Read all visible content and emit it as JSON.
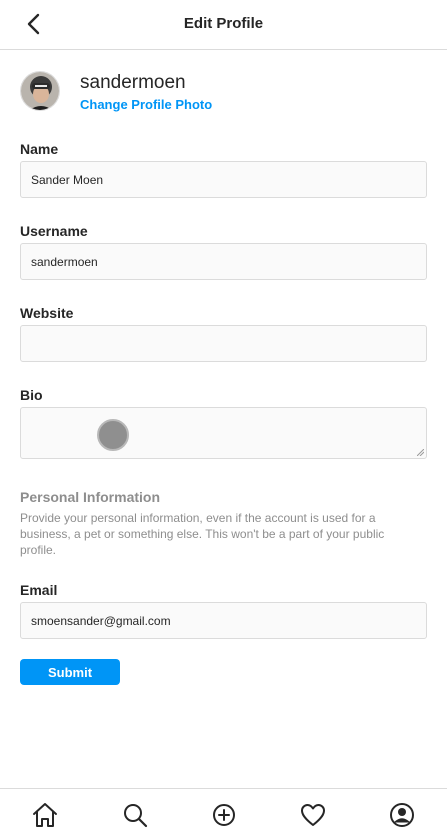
{
  "header": {
    "title": "Edit Profile",
    "back_icon": "chevron-left-icon"
  },
  "profile": {
    "username": "sandermoen",
    "change_photo_label": "Change Profile Photo"
  },
  "form": {
    "name": {
      "label": "Name",
      "value": "Sander Moen"
    },
    "username": {
      "label": "Username",
      "value": "sandermoen"
    },
    "website": {
      "label": "Website",
      "value": ""
    },
    "bio": {
      "label": "Bio",
      "value": ""
    },
    "personal_info": {
      "heading": "Personal Information",
      "description": "Provide your personal information, even if the account is used for a business, a pet or something else. This won't be a part of your public profile."
    },
    "email": {
      "label": "Email",
      "value": "smoensander@gmail.com"
    },
    "submit_label": "Submit"
  },
  "bottom_nav": {
    "items": [
      "home-icon",
      "search-icon",
      "add-post-icon",
      "heart-icon",
      "profile-icon"
    ]
  },
  "colors": {
    "accent": "#0095f6",
    "border": "#dbdbdb",
    "muted_text": "#8e8e8e",
    "input_bg": "#fafafa"
  }
}
